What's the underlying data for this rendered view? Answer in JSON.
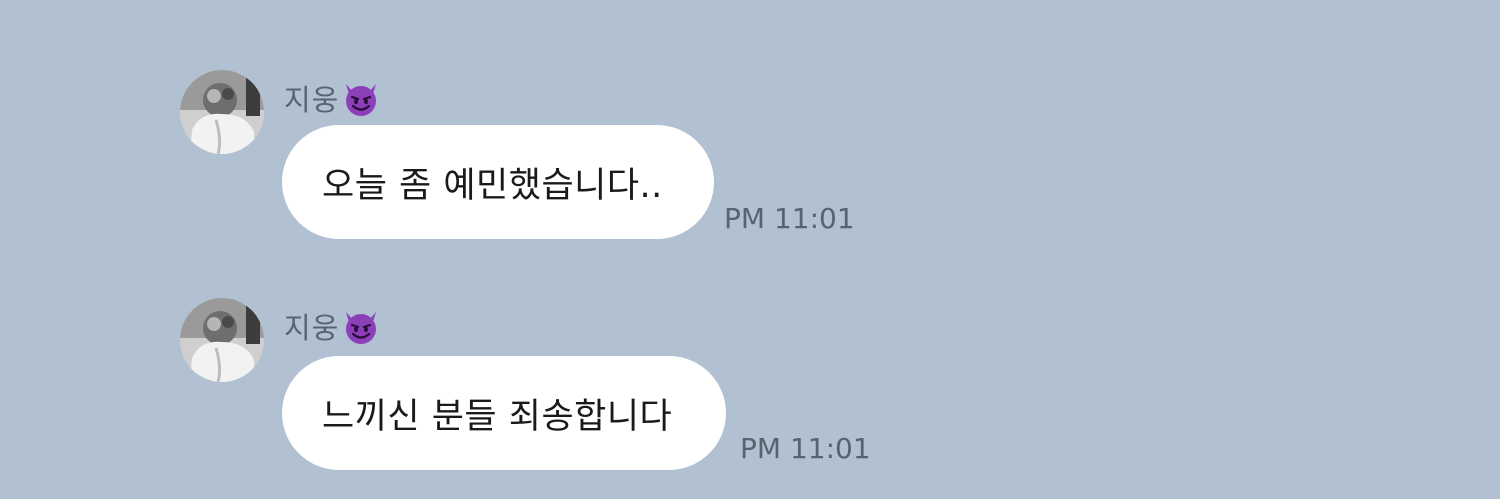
{
  "colors": {
    "background": "#b1c1d2",
    "bubble": "#ffffff",
    "sender_name": "#5a6470",
    "timestamp": "#58636f",
    "emoji_purple": "#8b3fb8"
  },
  "messages": [
    {
      "sender": "지웅",
      "sender_emoji_icon": "smiling-devil-icon",
      "text": "오늘 좀 예민했습니다..",
      "time": "PM 11:01"
    },
    {
      "sender": "지웅",
      "sender_emoji_icon": "smiling-devil-icon",
      "text": "느끼신 분들 죄송합니다",
      "time": "PM 11:01"
    }
  ]
}
